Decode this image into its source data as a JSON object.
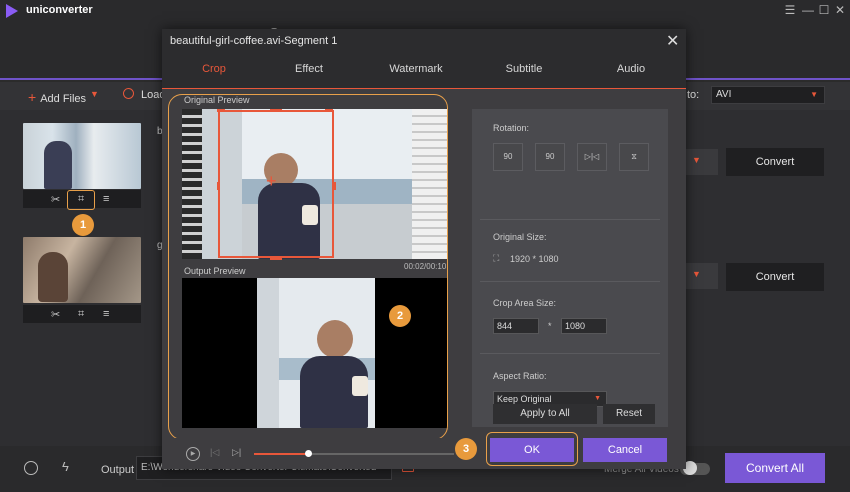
{
  "app": {
    "name": "uniconverter"
  },
  "toolbar": {
    "add_files": "Add Files",
    "load": "Load",
    "convert_to_label": "to:",
    "format": "AVI"
  },
  "files": [
    {
      "name_partial": "b",
      "convert": "Convert"
    },
    {
      "name_partial": "g",
      "convert": "Convert"
    }
  ],
  "bottom": {
    "output_label": "Output",
    "output_path": "E:\\Wondershare Video Converter Ultimate\\Converted",
    "merge_label": "Merge All Videos",
    "convert_all": "Convert All"
  },
  "dialog": {
    "title": "beautiful-girl-coffee.avi-Segment 1",
    "tabs": [
      "Crop",
      "Effect",
      "Watermark",
      "Subtitle",
      "Audio"
    ],
    "active_tab": "Crop",
    "original_preview_label": "Original Preview",
    "output_preview_label": "Output Preview",
    "timecode": "00:02/00:10",
    "rotation_label": "Rotation:",
    "rotation_buttons": [
      "90",
      "90"
    ],
    "original_size_label": "Original Size:",
    "original_size": "1920 * 1080",
    "crop_area_label": "Crop Area Size:",
    "crop_width": "844",
    "crop_sep": "*",
    "crop_height": "1080",
    "aspect_label": "Aspect Ratio:",
    "aspect_value": "Keep Original",
    "apply_all": "Apply to All",
    "reset": "Reset",
    "ok": "OK",
    "cancel": "Cancel",
    "progress": 0.27
  },
  "badges": [
    "1",
    "2",
    "3"
  ],
  "colors": {
    "accent": "#e8573a",
    "purple": "#7a58d6",
    "badge": "#e89a3c"
  }
}
